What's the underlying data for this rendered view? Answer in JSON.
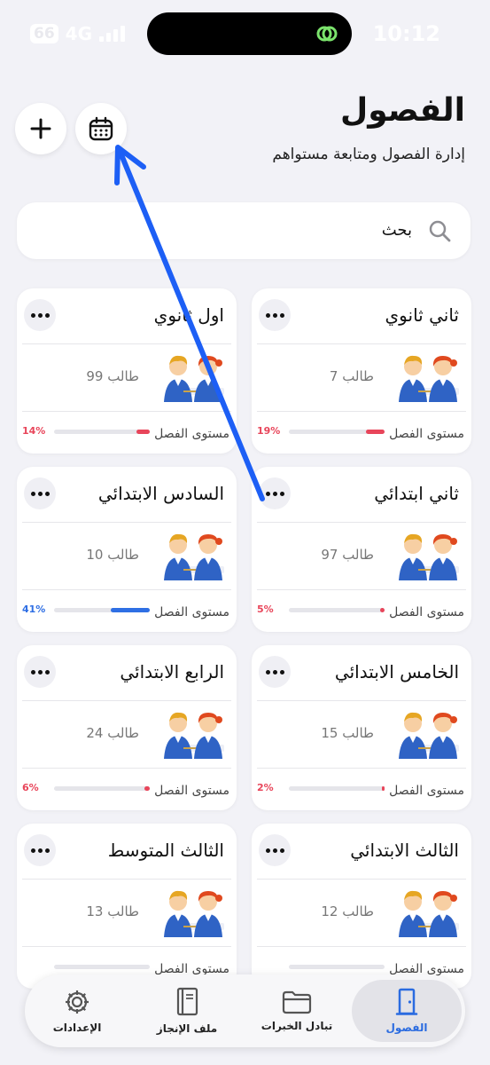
{
  "status": {
    "battery_text": "66",
    "network": "4G",
    "time": "10:12"
  },
  "header": {
    "title": "الفصول",
    "subtitle": "إدارة الفصول ومتابعة مستواهم",
    "add_icon": "plus-icon",
    "calendar_icon": "calendar-icon"
  },
  "search": {
    "placeholder": "بحث",
    "icon": "search-icon"
  },
  "common": {
    "level_label": "مستوى الفصل"
  },
  "classes": [
    {
      "title": "ثاني ثانوي",
      "count": "7 طالب",
      "percent": "19%",
      "level": 0.19,
      "color": "#E8455A"
    },
    {
      "title": "اول ثانوي",
      "count": "99 طالب",
      "percent": "14%",
      "level": 0.14,
      "color": "#E8455A"
    },
    {
      "title": "ثاني ابتدائي",
      "count": "97 طالب",
      "percent": "5%",
      "level": 0.05,
      "color": "#E8455A"
    },
    {
      "title": "السادس الابتدائي",
      "count": "10 طالب",
      "percent": "41%",
      "level": 0.41,
      "color": "#2F6FE4"
    },
    {
      "title": "الخامس الابتدائي",
      "count": "15 طالب",
      "percent": "2%",
      "level": 0.02,
      "color": "#E8455A"
    },
    {
      "title": "الرابع الابتدائي",
      "count": "24 طالب",
      "percent": "6%",
      "level": 0.06,
      "color": "#E8455A"
    },
    {
      "title": "الثالث الابتدائي",
      "count": "12 طالب",
      "percent": "",
      "level": 0,
      "color": "#E8455A"
    },
    {
      "title": "الثالث المتوسط",
      "count": "13 طالب",
      "percent": "",
      "level": 0,
      "color": "#E8455A"
    }
  ],
  "tabs": [
    {
      "label": "الفصول",
      "icon": "door-icon",
      "active": true
    },
    {
      "label": "تبادل الخبرات",
      "icon": "folder-icon",
      "active": false
    },
    {
      "label": "ملف الإنجاز",
      "icon": "notebook-icon",
      "active": false
    },
    {
      "label": "الإعدادات",
      "icon": "gear-icon",
      "active": false
    }
  ],
  "colors": {
    "accent": "#2A6BE0",
    "low": "#E8455A",
    "background": "#F2F2F7",
    "annotation_arrow": "#1D5FF5"
  }
}
